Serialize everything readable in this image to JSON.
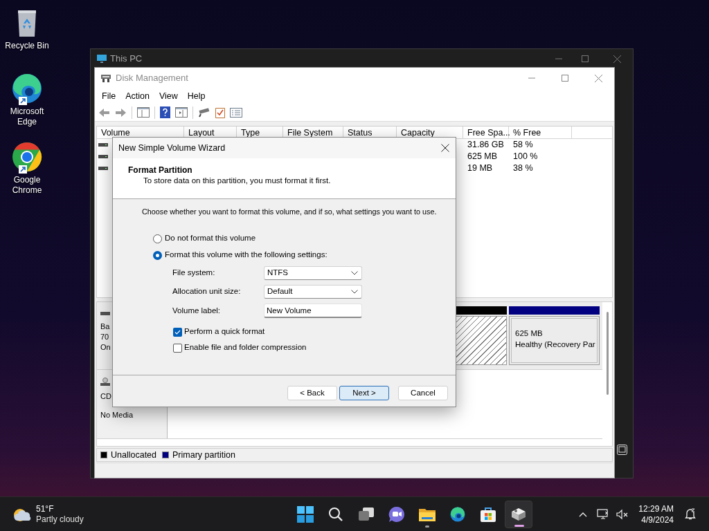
{
  "desktop_icons": [
    {
      "label": "Recycle Bin",
      "kind": "recycle-bin",
      "shortcut": false
    },
    {
      "label": "Microsoft Edge",
      "kind": "edge",
      "shortcut": true
    },
    {
      "label": "Google Chrome",
      "kind": "chrome",
      "shortcut": true
    }
  ],
  "this_pc_window": {
    "title": "This PC"
  },
  "disk_management": {
    "title": "Disk Management",
    "menu": [
      "File",
      "Action",
      "View",
      "Help"
    ],
    "columns": [
      "Volume",
      "Layout",
      "Type",
      "File System",
      "Status",
      "Capacity",
      "Free Spa...",
      "% Free"
    ],
    "rows": [
      {
        "free_space": "31.86 GB",
        "percent_free": "58 %"
      },
      {
        "free_space": "625 MB",
        "percent_free": "100 %"
      },
      {
        "free_space": "19 MB",
        "percent_free": "38 %"
      }
    ],
    "disks": [
      {
        "kind": "basic",
        "label_lines": [
          "Ba",
          "70",
          "On"
        ],
        "partitions": [
          {
            "kind": "unallocated",
            "color": "#000000"
          },
          {
            "kind": "primary",
            "color": "#000080",
            "lines": [
              "625 MB",
              "Healthy (Recovery Par"
            ]
          }
        ]
      },
      {
        "kind": "cdrom",
        "label_lines": [
          "CD",
          "No Media"
        ]
      }
    ],
    "legend": [
      {
        "label": "Unallocated",
        "color": "#000000"
      },
      {
        "label": "Primary partition",
        "color": "#000080"
      }
    ]
  },
  "wizard": {
    "title": "New Simple Volume Wizard",
    "heading": "Format Partition",
    "subheading": "To store data on this partition, you must format it first.",
    "instruction": "Choose whether you want to format this volume, and if so, what settings you want to use.",
    "options": [
      {
        "label": "Do not format this volume",
        "selected": false
      },
      {
        "label": "Format this volume with the following settings:",
        "selected": true
      }
    ],
    "settings": [
      {
        "label": "File system:",
        "value": "NTFS",
        "kind": "dropdown"
      },
      {
        "label": "Allocation unit size:",
        "value": "Default",
        "kind": "dropdown"
      },
      {
        "label": "Volume label:",
        "value": "New Volume",
        "kind": "text"
      }
    ],
    "checkboxes": [
      {
        "label": "Perform a quick format",
        "checked": true
      },
      {
        "label": "Enable file and folder compression",
        "checked": false
      }
    ],
    "buttons": [
      {
        "label": "< Back",
        "focused": false
      },
      {
        "label": "Next >",
        "focused": true
      },
      {
        "label": "Cancel",
        "focused": false
      }
    ]
  },
  "taskbar": {
    "weather": {
      "temperature": "51°F",
      "condition": "Partly cloudy"
    },
    "apps": [
      {
        "kind": "start",
        "running": false,
        "selected": false
      },
      {
        "kind": "search",
        "running": false,
        "selected": false
      },
      {
        "kind": "task-view",
        "running": false,
        "selected": false
      },
      {
        "kind": "chat",
        "running": false,
        "selected": false
      },
      {
        "kind": "explorer",
        "running": true,
        "selected": false
      },
      {
        "kind": "edge",
        "running": false,
        "selected": false
      },
      {
        "kind": "store",
        "running": false,
        "selected": false
      },
      {
        "kind": "disk",
        "running": true,
        "selected": true
      }
    ],
    "clock": {
      "time": "12:29 AM",
      "date": "4/9/2024"
    }
  }
}
